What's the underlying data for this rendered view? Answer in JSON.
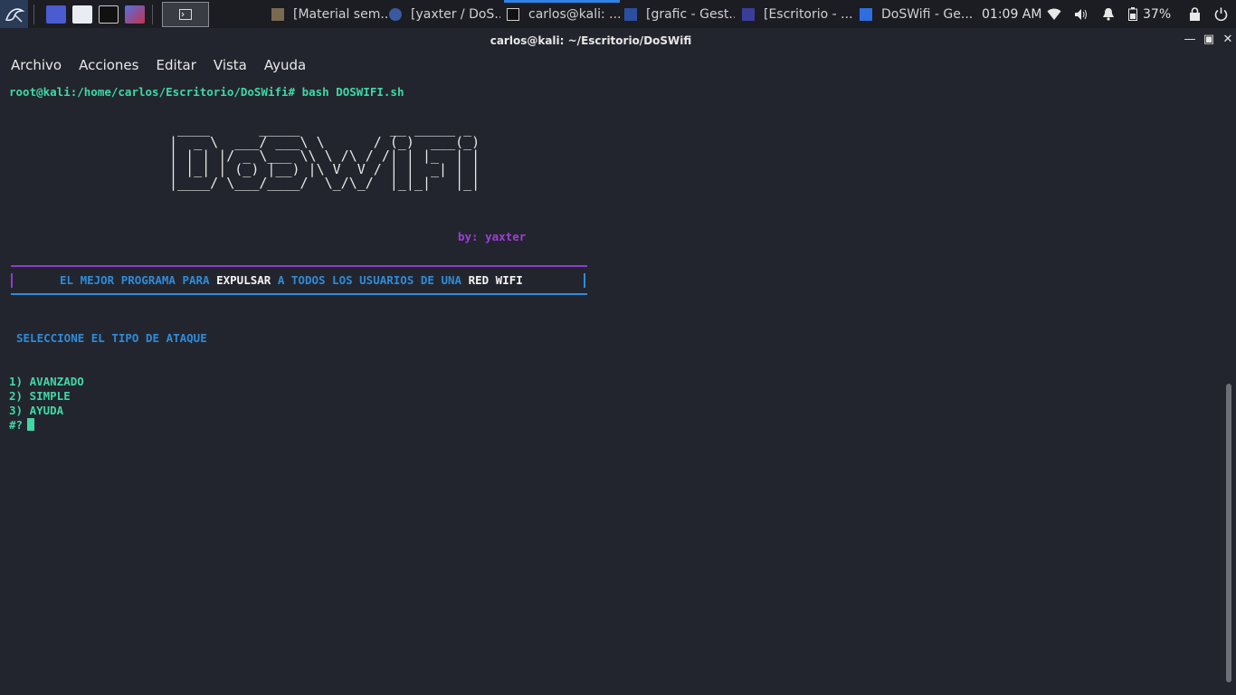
{
  "panel": {
    "tasks": [
      {
        "label": "[Material sem..."
      },
      {
        "label": "[yaxter / DoS..."
      },
      {
        "label": "carlos@kali: ..."
      },
      {
        "label": "[grafic - Gest..."
      },
      {
        "label": "[Escritorio - ..."
      },
      {
        "label": "DoSWifi - Ge..."
      }
    ],
    "clock": "01:09 AM",
    "battery": "37%"
  },
  "window": {
    "title": "carlos@kali: ~/Escritorio/DoSWifi",
    "menu": [
      "Archivo",
      "Acciones",
      "Editar",
      "Vista",
      "Ayuda"
    ]
  },
  "terminal": {
    "prompt_line": "root@kali:/home/carlos/Escritorio/DoSWifi# bash DOSWIFI.sh",
    "ascii_art": "  ____      _____           __ _____ _ \n |  _ \\  ___/ ___\\ \\      / (_)  ___(_)\n | | | |/ _ \\___ \\\\ \\ /\\ / /| | |_  | |\n | |_| | (_) |__) |\\ V  V / | |  _| | |\n |____/ \\___/____/  \\_/\\_/  |_|_|   |_|",
    "byline": "by: yaxter",
    "banner": {
      "part1": "EL MEJOR PROGRAMA PARA ",
      "part2": "EXPULSAR",
      "part3": " A TODOS LOS USUARIOS DE UNA ",
      "part4": "RED WIFI"
    },
    "select_prompt": "SELECCIONE EL TIPO DE ATAQUE",
    "options": [
      "1) AVANZADO",
      "2) SIMPLE",
      "3) AYUDA"
    ],
    "input_prompt": "#?"
  }
}
